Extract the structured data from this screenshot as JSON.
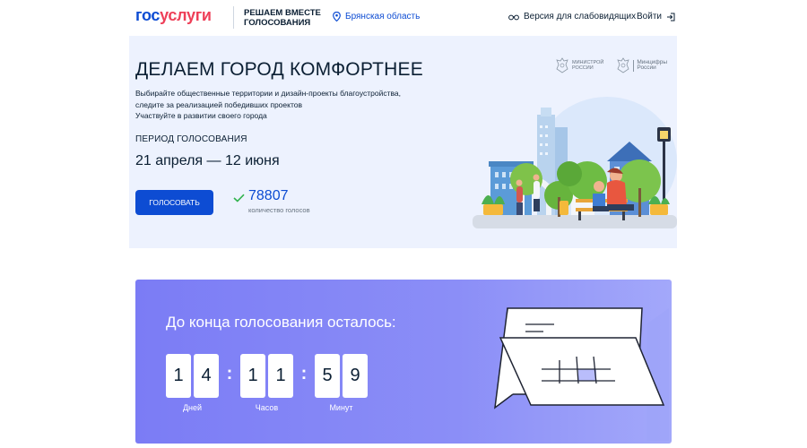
{
  "header": {
    "logo_part1": "гос",
    "logo_part2": "услуги",
    "slogan": "Решаем вместе голосования",
    "region": "Брянская область",
    "visually_impaired": "Версия для слабовидящих",
    "login": "Войти",
    "icons": {
      "region": "location-pin-icon",
      "visually_impaired": "glasses-icon",
      "login": "login-arrow-icon"
    }
  },
  "hero": {
    "title": "ДЕЛАЕМ ГОРОД КОМФОРТНЕЕ",
    "description_lines": [
      "Выбирайте общественные территории и дизайн-проекты благоустройства,",
      "следите за реализацией победивших проектов",
      "Участвуйте в развитии своего города"
    ],
    "period_label": "ПЕРИОД ГОЛОСОВАНИЯ",
    "period_dates": "21 апреля — 12 июня",
    "vote_button": "ГОЛОСОВАТЬ",
    "votes_count": "78807",
    "votes_label": "количество голосов",
    "ministry_1": "МИНИСТРОЙ РОССИИ",
    "ministry_1_lines": [
      "МИНИСТРОЙ",
      "РОССИИ"
    ],
    "ministry_2": "Минцифры России",
    "ministry_2_lines": [
      "Минцифры",
      "России"
    ]
  },
  "countdown": {
    "title": "До конца голосования осталось:",
    "days": [
      "1",
      "4"
    ],
    "hours": [
      "1",
      "1"
    ],
    "minutes": [
      "5",
      "9"
    ],
    "days_label": "Дней",
    "hours_label": "Часов",
    "minutes_label": "Минут"
  },
  "colors": {
    "brand_blue": "#0d4cd3",
    "brand_red": "#ee3f58",
    "hero_bg": "#edf2fe",
    "countdown_bg": "#8b8ef7"
  }
}
